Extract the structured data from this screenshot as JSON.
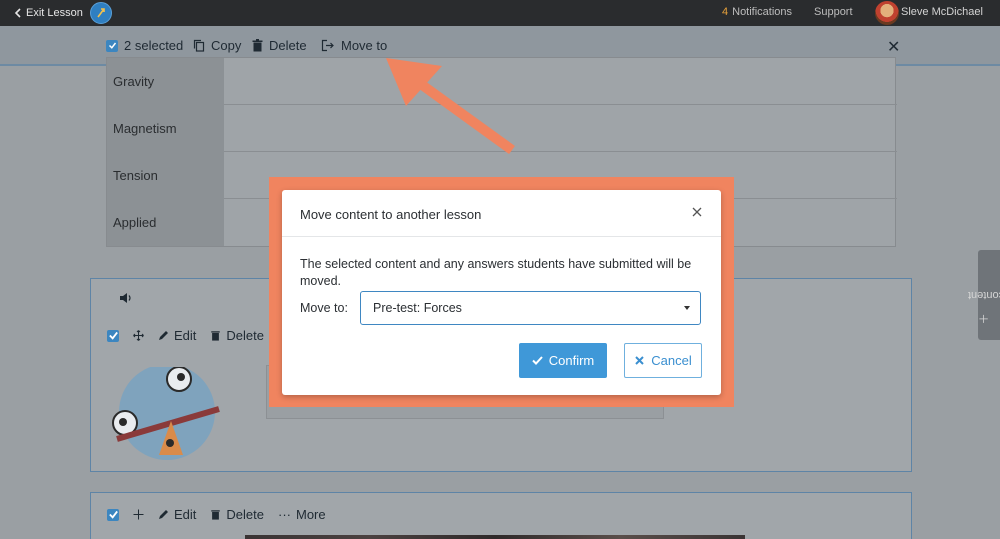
{
  "topbar": {
    "exit_label": "Exit Lesson",
    "notifications_count": "4",
    "notifications_label": "Notifications",
    "support_label": "Support",
    "user_name": "Sleve McDichael"
  },
  "selection_bar": {
    "selected_label": "2 selected",
    "copy_label": "Copy",
    "delete_label": "Delete",
    "move_label": "Move to"
  },
  "table": {
    "rows": [
      "Gravity",
      "Magnetism",
      "Tension",
      "Applied"
    ]
  },
  "block_tools": {
    "edit_label": "Edit",
    "delete_label": "Delete",
    "more_label": "More"
  },
  "sidebar": {
    "add_content_label": "Add content"
  },
  "dialog": {
    "title": "Move content to another lesson",
    "message": "The selected content and any answers students have submitted will be moved.",
    "move_to_label": "Move to:",
    "selected_lesson": "Pre-test: Forces",
    "confirm_label": "Confirm",
    "cancel_label": "Cancel"
  },
  "colors": {
    "highlight": "#f0845f",
    "primary": "#3f98d8",
    "topbar": "#2a2c2e"
  }
}
